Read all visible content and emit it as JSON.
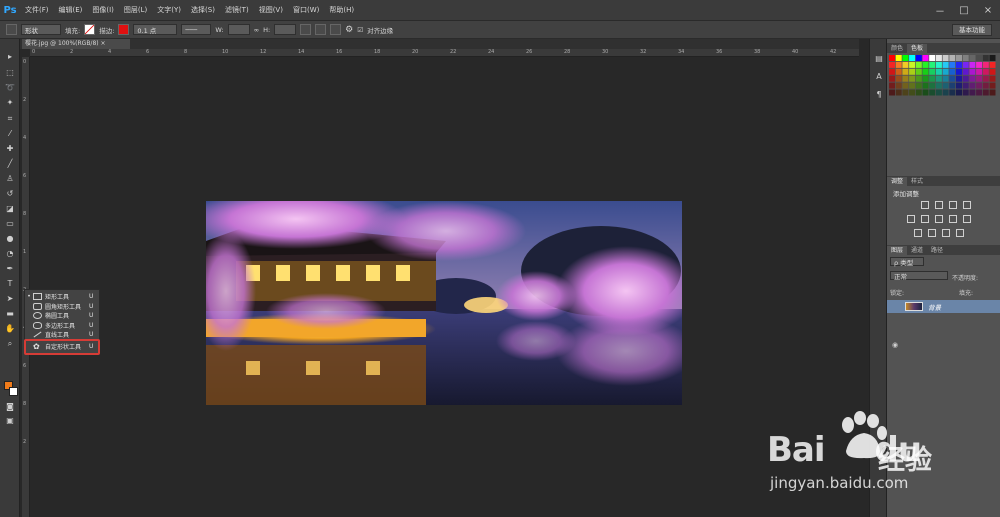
{
  "app": {
    "logo": "Ps"
  },
  "menu": [
    "文件(F)",
    "编辑(E)",
    "图像(I)",
    "图层(L)",
    "文字(Y)",
    "选择(S)",
    "滤镜(T)",
    "视图(V)",
    "窗口(W)",
    "帮助(H)"
  ],
  "window_controls": [
    "－",
    "□",
    "×"
  ],
  "options": {
    "shape_mode": "形状",
    "fill_label": "填充:",
    "stroke_label": "描边:",
    "stroke_color": "#e01010",
    "stroke_width": "0.1 点",
    "w_label": "W:",
    "h_label": "H:",
    "align_edges_label": "对齐边缘",
    "workspace": "基本功能"
  },
  "document": {
    "tab_title": "樱花.jpg @ 100%(RGB/8)"
  },
  "ruler_top_ticks": [
    "0",
    "2",
    "4",
    "6",
    "8",
    "10",
    "12",
    "14",
    "16",
    "18",
    "20",
    "22",
    "24",
    "26",
    "28",
    "30",
    "32",
    "34",
    "36",
    "38",
    "40",
    "42"
  ],
  "ruler_left_ticks": [
    "0",
    "2",
    "4",
    "6",
    "8",
    "1",
    "2",
    "4",
    "6",
    "8",
    "2"
  ],
  "flyout": {
    "items": [
      {
        "label": "矩形工具",
        "key": "U",
        "bullet": "•"
      },
      {
        "label": "圆角矩形工具",
        "key": "U",
        "bullet": ""
      },
      {
        "label": "椭圆工具",
        "key": "U",
        "bullet": ""
      },
      {
        "label": "多边形工具",
        "key": "U",
        "bullet": ""
      },
      {
        "label": "直线工具",
        "key": "U",
        "bullet": ""
      },
      {
        "label": "自定形状工具",
        "key": "U",
        "bullet": ""
      }
    ],
    "highlight_color": "#d63c36"
  },
  "colors": {
    "foreground": "#f07b1a",
    "background": "#ffffff"
  },
  "panels": {
    "color_tabs": [
      "颜色",
      "色板"
    ],
    "adjust_tabs": [
      "调整",
      "样式"
    ],
    "adjust_title": "添加调整",
    "layer_tabs": [
      "图层",
      "通道",
      "路径"
    ],
    "layer_kind": "ρ 类型",
    "blend_mode": "正常",
    "opacity_label": "不透明度:",
    "lock_label": "锁定:",
    "fill_label": "填充:",
    "layer_name": "背景"
  },
  "watermark": {
    "brand": "Bai",
    "brand2": "du",
    "cn": "经验",
    "url": "jingyan.baidu.com"
  }
}
